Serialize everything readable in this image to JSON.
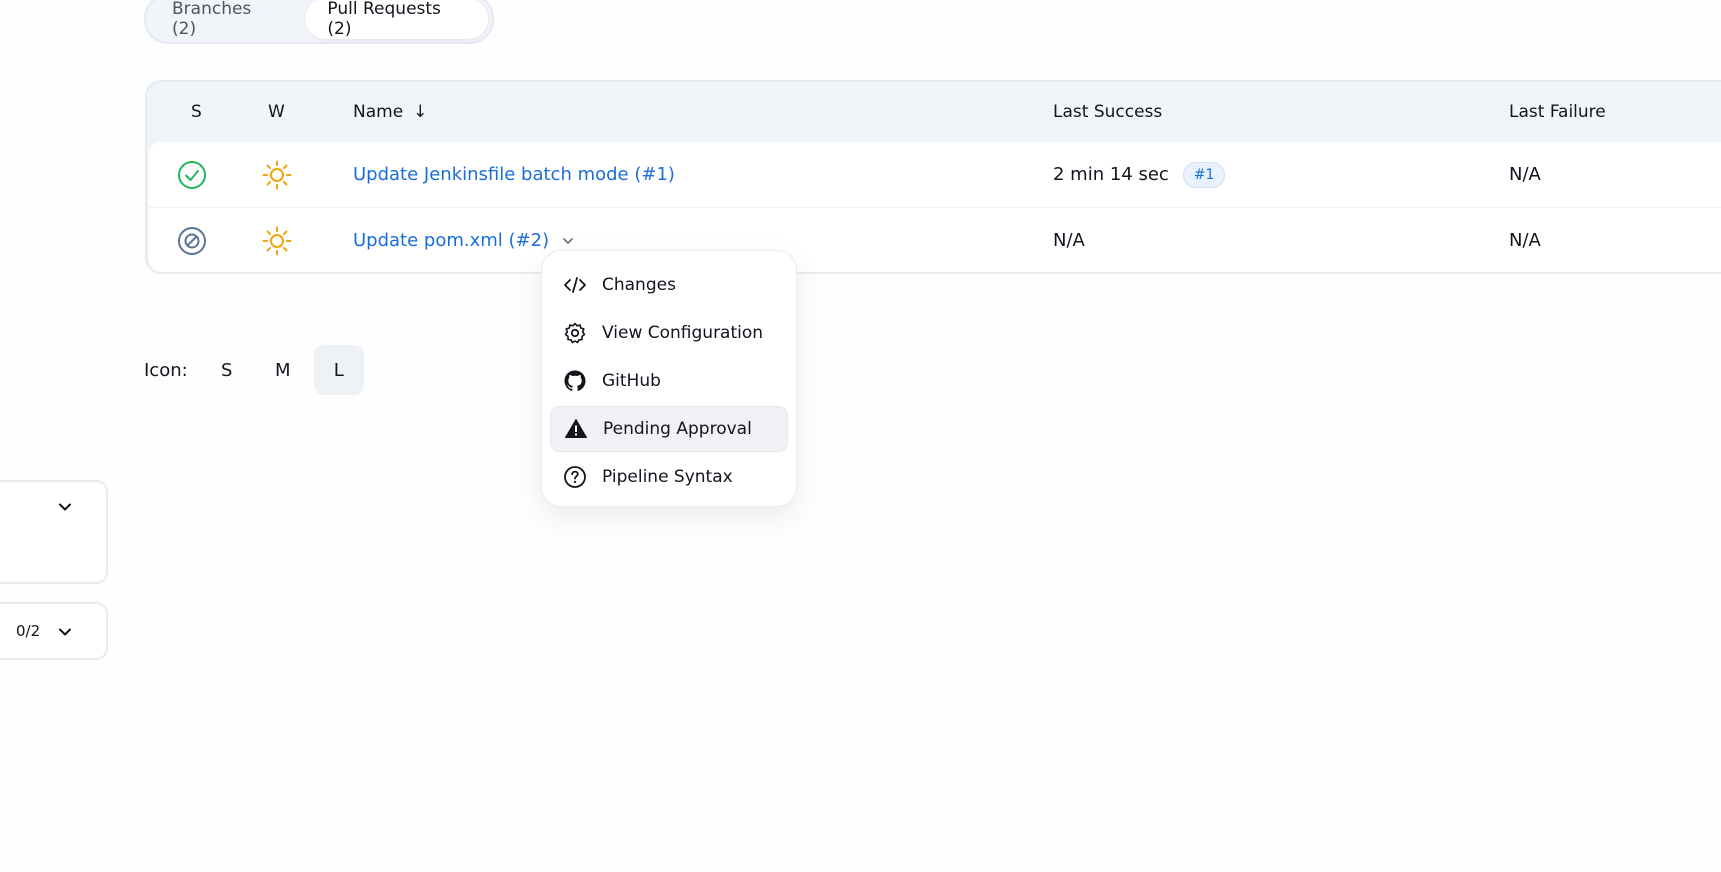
{
  "tabs": {
    "branches": "Branches (2)",
    "pull_requests": "Pull Requests (2)"
  },
  "table": {
    "columns": {
      "s": "S",
      "w": "W",
      "name": "Name",
      "name_sort": "↓",
      "last_success": "Last Success",
      "last_failure": "Last Failure"
    },
    "rows": [
      {
        "status_icon": "success-check-icon",
        "weather_icon": "sunny-icon",
        "name": "Update Jenkinsfile batch mode (#1)",
        "last_success": "2 min 14 sec",
        "last_success_build": "#1",
        "last_failure": "N/A"
      },
      {
        "status_icon": "not-built-icon",
        "weather_icon": "sunny-icon",
        "name": "Update pom.xml (#2)",
        "last_success": "N/A",
        "last_failure": "N/A"
      }
    ]
  },
  "dropdown_menu": {
    "items": [
      {
        "label": "Changes",
        "icon": "code-icon"
      },
      {
        "label": "View Configuration",
        "icon": "gear-icon"
      },
      {
        "label": "GitHub",
        "icon": "github-icon"
      },
      {
        "label": "Pending Approval",
        "icon": "warning-icon"
      },
      {
        "label": "Pipeline Syntax",
        "icon": "help-circle-icon"
      }
    ]
  },
  "icon_size": {
    "label": "Icon:",
    "options": [
      "S",
      "M",
      "L"
    ],
    "selected": "L"
  },
  "side_panels": {
    "queue_count": "0/2"
  },
  "colors": {
    "link": "#1a6ed8",
    "success": "#1fb85c",
    "not_built": "#5a7499",
    "sunny": "#f5a30a"
  }
}
